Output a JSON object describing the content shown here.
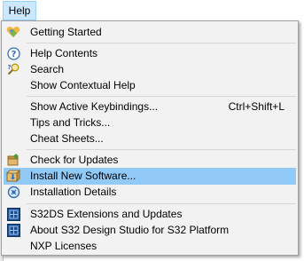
{
  "menubar": {
    "help_label": "Help"
  },
  "menu": {
    "items": [
      {
        "label": "Getting Started",
        "icon": "getting-started-icon"
      },
      {
        "label": "Help Contents",
        "icon": "help-contents-icon"
      },
      {
        "label": "Search",
        "icon": "search-help-icon"
      },
      {
        "label": "Show Contextual Help",
        "icon": ""
      },
      {
        "label": "Show Active Keybindings...",
        "shortcut": "Ctrl+Shift+L",
        "icon": ""
      },
      {
        "label": "Tips and Tricks...",
        "icon": ""
      },
      {
        "label": "Cheat Sheets...",
        "icon": ""
      },
      {
        "label": "Check for Updates",
        "icon": "check-updates-icon"
      },
      {
        "label": "Install New Software...",
        "icon": "install-software-icon"
      },
      {
        "label": "Installation Details",
        "icon": "installation-details-icon"
      },
      {
        "label": "S32DS Extensions and Updates",
        "icon": "s32ds-icon"
      },
      {
        "label": "About S32 Design Studio for S32 Platform",
        "icon": "s32ds-icon"
      },
      {
        "label": "NXP Licenses",
        "icon": ""
      }
    ],
    "highlighted_item": "Install New Software..."
  },
  "colors": {
    "menu_background": "#f2f2f2",
    "highlight": "#91c9f7",
    "menubar_active": "#cce8ff"
  }
}
